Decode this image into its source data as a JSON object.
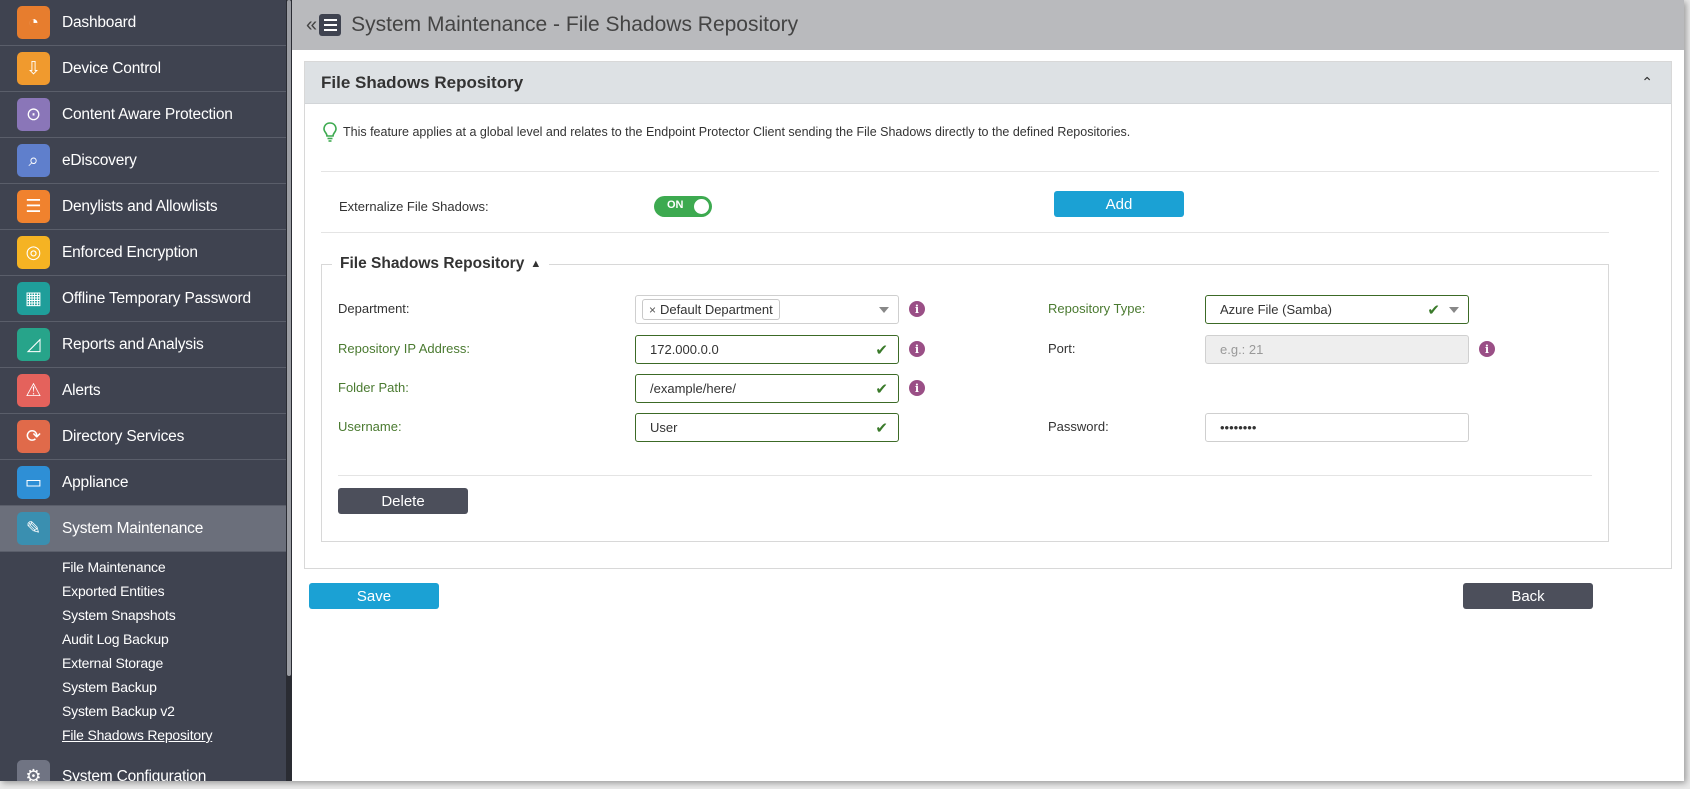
{
  "sidebar": {
    "items": [
      {
        "label": "Dashboard",
        "icon": "dashboard-icon",
        "color": "#e77d2e",
        "glyph": "◔"
      },
      {
        "label": "Device Control",
        "icon": "usb-icon",
        "color": "#f09a2e",
        "glyph": "⇩"
      },
      {
        "label": "Content Aware Protection",
        "icon": "content-protection-icon",
        "color": "#8a76b8",
        "glyph": "⊙"
      },
      {
        "label": "eDiscovery",
        "icon": "telescope-icon",
        "color": "#5f7fcc",
        "glyph": "⌕"
      },
      {
        "label": "Denylists and Allowlists",
        "icon": "list-icon",
        "color": "#f0822e",
        "glyph": "☰"
      },
      {
        "label": "Enforced Encryption",
        "icon": "encryption-icon",
        "color": "#f5b323",
        "glyph": "◎"
      },
      {
        "label": "Offline Temporary Password",
        "icon": "keypad-icon",
        "color": "#1f9e9a",
        "glyph": "▦"
      },
      {
        "label": "Reports and Analysis",
        "icon": "chart-icon",
        "color": "#27a48a",
        "glyph": "◿"
      },
      {
        "label": "Alerts",
        "icon": "alert-icon",
        "color": "#e4625c",
        "glyph": "⚠"
      },
      {
        "label": "Directory Services",
        "icon": "directory-icon",
        "color": "#e06a4a",
        "glyph": "⟳"
      },
      {
        "label": "Appliance",
        "icon": "appliance-icon",
        "color": "#2e8fd6",
        "glyph": "▭"
      },
      {
        "label": "System Maintenance",
        "icon": "tools-icon",
        "color": "#3a8fb0",
        "glyph": "✎"
      }
    ],
    "sub_items": [
      "File Maintenance",
      "Exported Entities",
      "System Snapshots",
      "Audit Log Backup",
      "External Storage",
      "System Backup",
      "System Backup v2",
      "File Shadows Repository"
    ],
    "bottom_item": {
      "label": "System Configuration",
      "icon": "gear-icon",
      "color": "#707483",
      "glyph": "⚙"
    }
  },
  "header": {
    "collapse": "«",
    "title": "System Maintenance - File Shadows Repository"
  },
  "panel": {
    "title": "File Shadows Repository",
    "notice": "This feature applies at a global level and relates to the Endpoint Protector Client sending the File Shadows directly to the defined Repositories.",
    "externalize_label": "Externalize File Shadows:",
    "toggle_text": "ON",
    "add_label": "Add",
    "repo": {
      "legend": "File Shadows Repository",
      "department_label": "Department:",
      "department_tag": "Default Department",
      "repo_type_label": "Repository Type:",
      "repo_type_value": "Azure File (Samba)",
      "ip_label": "Repository IP Address:",
      "ip_value": "172.000.0.0",
      "port_label": "Port:",
      "port_placeholder": "e.g.: 21",
      "folder_label": "Folder Path:",
      "folder_value": "/example/here/",
      "username_label": "Username:",
      "username_value": "User",
      "password_label": "Password:",
      "password_value": "••••••••",
      "delete_label": "Delete"
    }
  },
  "footer": {
    "save_label": "Save",
    "back_label": "Back"
  },
  "colors": {
    "sidebar_bg": "#3f4350",
    "accent_blue": "#1ba1d4",
    "toggle_green": "#3daa50",
    "info_purple": "#9a4f86",
    "valid_green": "#3c6a26"
  }
}
